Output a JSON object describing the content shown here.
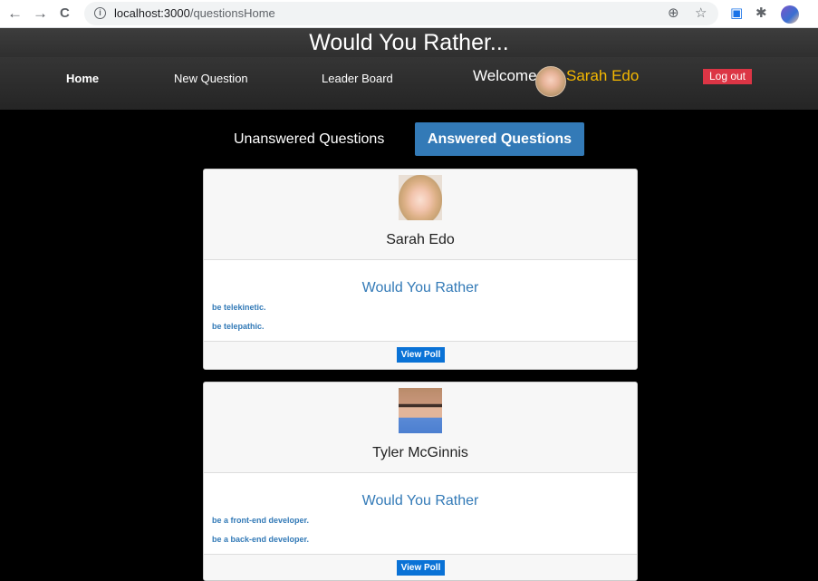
{
  "browser": {
    "url_host": "localhost:3000",
    "url_path": "/questionsHome",
    "back_icon": "←",
    "forward_icon": "→",
    "reload_icon": "C",
    "info_icon": "i",
    "zoom_icon": "⊕",
    "star_icon": "☆",
    "cast_icon": "▣",
    "extensions_icon": "✱",
    "menu_icon": "⋮"
  },
  "app": {
    "title": "Would You Rather..."
  },
  "nav": {
    "home": "Home",
    "new_question": "New Question",
    "leader_board": "Leader Board",
    "welcome": "Welcome",
    "user_name": "Sarah Edo",
    "logout": "Log out"
  },
  "tabs": {
    "unanswered": "Unanswered Questions",
    "answered": "Answered Questions",
    "active": "answered"
  },
  "colors": {
    "accent": "#337ab7",
    "user_name": "#f5b800",
    "logout": "#dc3545",
    "view_poll": "#0a72d6"
  },
  "questions": [
    {
      "author": "Sarah Edo",
      "heading": "Would You Rather",
      "option_one": "be telekinetic.",
      "option_two": "be telepathic.",
      "button": "View Poll"
    },
    {
      "author": "Tyler McGinnis",
      "heading": "Would You Rather",
      "option_one": "be a front-end developer.",
      "option_two": "be a back-end developer.",
      "button": "View Poll"
    }
  ]
}
